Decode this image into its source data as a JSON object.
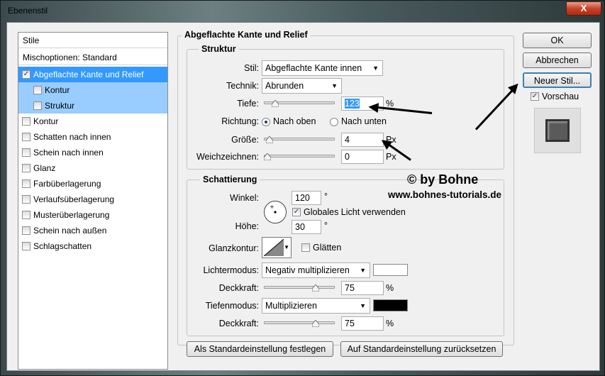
{
  "window": {
    "title": "Ebenenstil",
    "close_label": "X"
  },
  "styles": {
    "header": "Stile",
    "blending": "Mischoptionen: Standard",
    "items": [
      {
        "label": "Abgeflachte Kante und Relief",
        "checked": true
      },
      {
        "label": "Kontur",
        "checked": false
      },
      {
        "label": "Struktur",
        "checked": false
      },
      {
        "label": "Kontur",
        "checked": false
      },
      {
        "label": "Schatten nach innen",
        "checked": false
      },
      {
        "label": "Schein nach innen",
        "checked": false
      },
      {
        "label": "Glanz",
        "checked": false
      },
      {
        "label": "Farbüberlagerung",
        "checked": false
      },
      {
        "label": "Verlaufsüberlagerung",
        "checked": false
      },
      {
        "label": "Musterüberlagerung",
        "checked": false
      },
      {
        "label": "Schein nach außen",
        "checked": false
      },
      {
        "label": "Schlagschatten",
        "checked": false
      }
    ]
  },
  "bevel": {
    "title": "Abgeflachte Kante und Relief",
    "structure": {
      "title": "Struktur",
      "style_label": "Stil:",
      "style_value": "Abgeflachte Kante innen",
      "technique_label": "Technik:",
      "technique_value": "Abrunden",
      "depth_label": "Tiefe:",
      "depth_value": "123",
      "depth_unit": "%",
      "depth_pct": 0.12,
      "direction_label": "Richtung:",
      "dir_up": "Nach oben",
      "dir_down": "Nach unten",
      "size_label": "Größe:",
      "size_value": "4",
      "size_unit": "Px",
      "size_pct": 0.03,
      "soften_label": "Weichzeichnen:",
      "soften_value": "0",
      "soften_unit": "Px",
      "soften_pct": 0.0
    },
    "shading": {
      "title": "Schattierung",
      "angle_label": "Winkel:",
      "angle_value": "120",
      "angle_unit": "°",
      "global_light": "Globales Licht verwenden",
      "altitude_label": "Höhe:",
      "altitude_value": "30",
      "altitude_unit": "°",
      "gloss_label": "Glanzkontur:",
      "antialias": "Glätten",
      "highlight_label": "Lichtermodus:",
      "highlight_value": "Negativ multiplizieren",
      "highlight_color": "#ffffff",
      "opacity1_label": "Deckkraft:",
      "opacity1_value": "75",
      "opacity1_unit": "%",
      "opacity1_pct": 0.75,
      "shadow_label": "Tiefenmodus:",
      "shadow_value": "Multiplizieren",
      "shadow_color": "#000000",
      "opacity2_label": "Deckkraft:",
      "opacity2_value": "75",
      "opacity2_unit": "%",
      "opacity2_pct": 0.75
    },
    "make_default": "Als Standardeinstellung festlegen",
    "reset_default": "Auf Standardeinstellung zurücksetzen"
  },
  "buttons": {
    "ok": "OK",
    "cancel": "Abbrechen",
    "new_style": "Neuer Stil...",
    "preview": "Vorschau"
  },
  "watermark": {
    "line1": "© by Bohne",
    "line2": "www.bohnes-tutorials.de"
  }
}
